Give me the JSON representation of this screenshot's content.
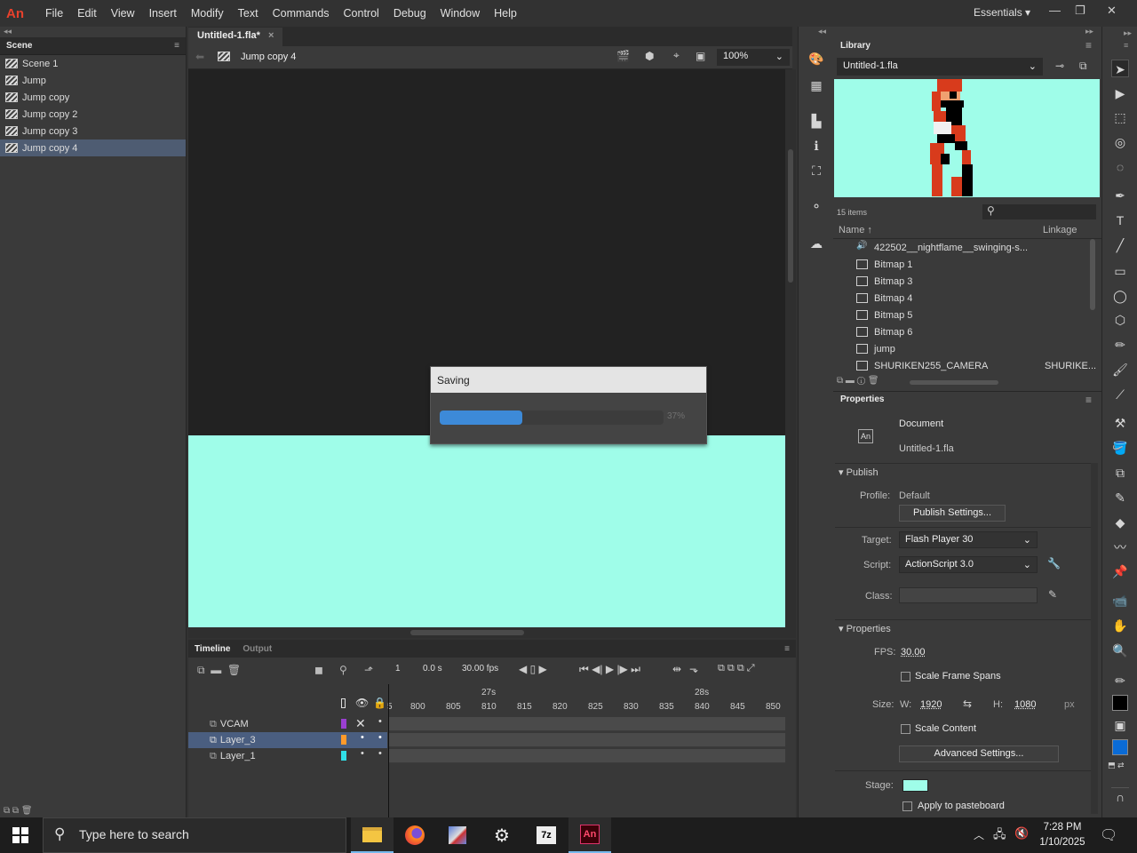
{
  "app": {
    "logo": "An",
    "menu": [
      "File",
      "Edit",
      "View",
      "Insert",
      "Modify",
      "Text",
      "Commands",
      "Control",
      "Debug",
      "Window",
      "Help"
    ],
    "workspace": "Essentials"
  },
  "scenes": {
    "tab": "Scene",
    "items": [
      "Scene 1",
      "Jump",
      "Jump copy",
      "Jump copy 2",
      "Jump copy 3",
      "Jump copy 4"
    ],
    "selected": "Jump copy 4"
  },
  "document": {
    "tab_title": "Untitled-1.fla*",
    "current_scene": "Jump copy 4",
    "zoom": "100%",
    "stage_color": "#9ffde9"
  },
  "saving_dialog": {
    "title": "Saving",
    "percent_label": "37%",
    "progress": 0.37
  },
  "timeline": {
    "tabs": [
      "Timeline",
      "Output"
    ],
    "current_frame": "1",
    "time": "0.0 s",
    "fps": "30.00 fps",
    "time_markers": [
      "27s",
      "28s"
    ],
    "frame_numbers": [
      "5",
      "800",
      "805",
      "810",
      "815",
      "820",
      "825",
      "830",
      "835",
      "840",
      "845",
      "850"
    ],
    "layers": [
      {
        "name": "VCAM",
        "color": "#9a3fd0"
      },
      {
        "name": "Layer_3",
        "color": "#ff9a2a"
      },
      {
        "name": "Layer_1",
        "color": "#30e0e8"
      }
    ]
  },
  "library": {
    "tab": "Library",
    "file": "Untitled-1.fla",
    "count": "15 items",
    "col_name": "Name",
    "col_linkage": "Linkage",
    "items": [
      {
        "name": "422502__nightflame__swinging-s...",
        "linkage": "",
        "icon": "sound-icon"
      },
      {
        "name": "Bitmap 1",
        "linkage": "",
        "icon": "bitmap-icon"
      },
      {
        "name": "Bitmap 3",
        "linkage": "",
        "icon": "bitmap-icon"
      },
      {
        "name": "Bitmap 4",
        "linkage": "",
        "icon": "bitmap-icon"
      },
      {
        "name": "Bitmap 5",
        "linkage": "",
        "icon": "bitmap-icon"
      },
      {
        "name": "Bitmap 6",
        "linkage": "",
        "icon": "bitmap-icon"
      },
      {
        "name": "jump",
        "linkage": "",
        "icon": "movieclip-icon"
      },
      {
        "name": "SHURIKEN255_CAMERA",
        "linkage": "SHURIKE...",
        "icon": "movieclip-icon"
      }
    ]
  },
  "properties": {
    "tab": "Properties",
    "type": "Document",
    "filename": "Untitled-1.fla",
    "publish_header": "Publish",
    "profile_label": "Profile:",
    "profile_value": "Default",
    "publish_settings_btn": "Publish Settings...",
    "target_label": "Target:",
    "target_value": "Flash Player 30",
    "script_label": "Script:",
    "script_value": "ActionScript 3.0",
    "class_label": "Class:",
    "properties_header": "Properties",
    "fps_label": "FPS:",
    "fps_value": "30.00",
    "scale_frame_spans": "Scale Frame Spans",
    "size_label": "Size:",
    "w_label": "W:",
    "w_value": "1920",
    "h_label": "H:",
    "h_value": "1080",
    "unit": "px",
    "scale_content": "Scale Content",
    "advanced_btn": "Advanced Settings...",
    "stage_label": "Stage:",
    "stage_color": "#9ffde9",
    "apply_pasteboard": "Apply to pasteboard"
  },
  "taskbar": {
    "search_placeholder": "Type here to search",
    "time": "7:28 PM",
    "date": "1/10/2025",
    "apps": [
      "file-explorer-icon",
      "firefox-icon",
      "app-icon",
      "settings-icon",
      "7zip-icon",
      "animate-icon"
    ]
  }
}
